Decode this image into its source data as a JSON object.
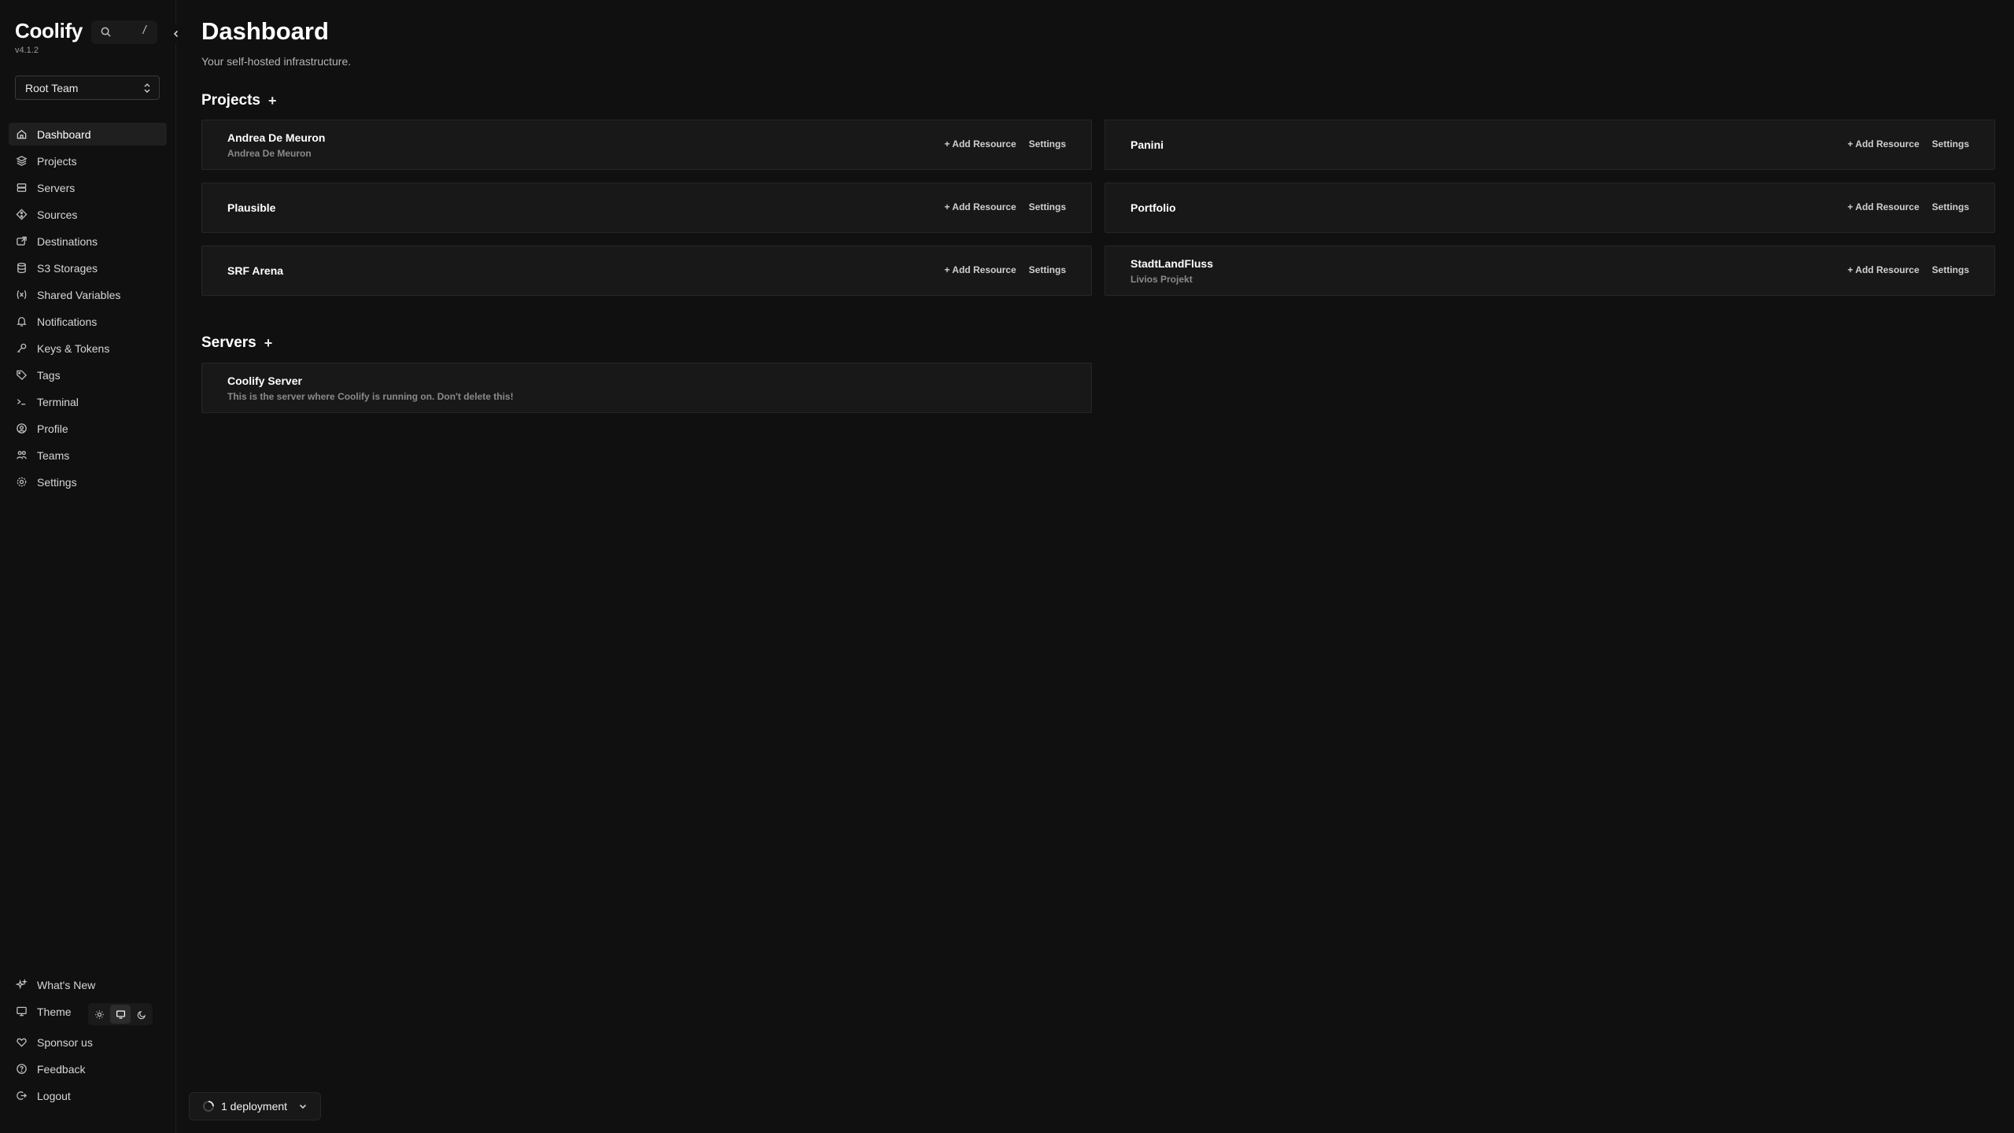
{
  "app": {
    "name": "Coolify",
    "version": "v4.1.2",
    "search_shortcut": "/"
  },
  "team": {
    "selected": "Root Team"
  },
  "nav": [
    {
      "label": "Dashboard",
      "icon": "home-icon",
      "active": true
    },
    {
      "label": "Projects",
      "icon": "layers-icon"
    },
    {
      "label": "Servers",
      "icon": "server-icon"
    },
    {
      "label": "Sources",
      "icon": "git-branch-icon"
    },
    {
      "label": "Destinations",
      "icon": "destination-icon"
    },
    {
      "label": "S3 Storages",
      "icon": "database-icon"
    },
    {
      "label": "Shared Variables",
      "icon": "variable-icon"
    },
    {
      "label": "Notifications",
      "icon": "bell-icon"
    },
    {
      "label": "Keys & Tokens",
      "icon": "key-icon"
    },
    {
      "label": "Tags",
      "icon": "tag-icon"
    },
    {
      "label": "Terminal",
      "icon": "terminal-icon"
    },
    {
      "label": "Profile",
      "icon": "user-circle-icon"
    },
    {
      "label": "Teams",
      "icon": "users-icon"
    },
    {
      "label": "Settings",
      "icon": "gear-icon"
    }
  ],
  "bottom_nav": {
    "whats_new": "What's New",
    "theme": "Theme",
    "sponsor": "Sponsor us",
    "feedback": "Feedback",
    "logout": "Logout"
  },
  "page": {
    "title": "Dashboard",
    "subtitle": "Your self-hosted infrastructure."
  },
  "projects": {
    "heading": "Projects",
    "add": "+",
    "add_resource_label": "+ Add Resource",
    "settings_label": "Settings",
    "items": [
      {
        "name": "Andrea De Meuron",
        "description": "Andrea De Meuron"
      },
      {
        "name": "Panini",
        "description": ""
      },
      {
        "name": "Plausible",
        "description": ""
      },
      {
        "name": "Portfolio",
        "description": ""
      },
      {
        "name": "SRF Arena",
        "description": ""
      },
      {
        "name": "StadtLandFluss",
        "description": "Livios Projekt"
      }
    ]
  },
  "servers": {
    "heading": "Servers",
    "add": "+",
    "items": [
      {
        "name": "Coolify Server",
        "description": "This is the server where Coolify is running on. Don't delete this!"
      }
    ]
  },
  "deployments": {
    "label": "1 deployment"
  }
}
